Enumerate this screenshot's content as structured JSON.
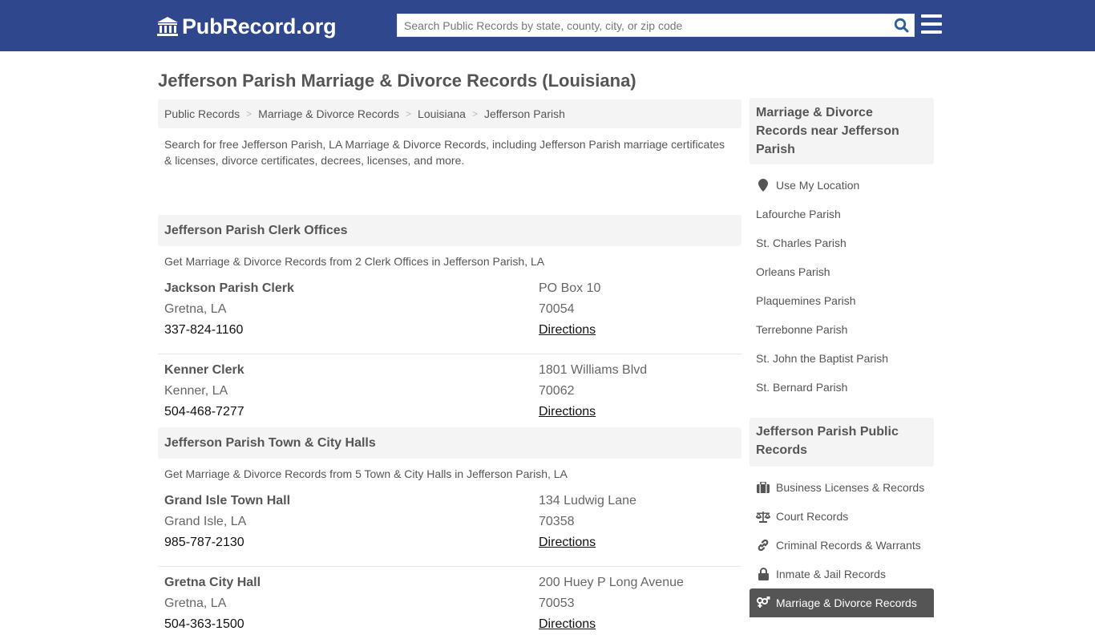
{
  "header": {
    "logo_text": "PubRecord.org",
    "search_placeholder": "Search Public Records by state, county, city, or zip code",
    "brand_color": "#2f478d"
  },
  "page_title": "Jefferson Parish Marriage & Divorce Records (Louisiana)",
  "breadcrumb": [
    {
      "label": "Public Records"
    },
    {
      "label": "Marriage & Divorce Records"
    },
    {
      "label": "Louisiana"
    },
    {
      "label": "Jefferson Parish"
    }
  ],
  "intro": "Search for free Jefferson Parish, LA Marriage & Divorce Records, including Jefferson Parish marriage certificates & licenses, divorce certificates, decrees, licenses, and more.",
  "sections": [
    {
      "title": "Jefferson Parish Clerk Offices",
      "description": "Get Marriage & Divorce Records from 2 Clerk Offices in Jefferson Parish, LA",
      "records": [
        {
          "name": "Jackson Parish Clerk",
          "city": "Gretna, LA",
          "phone": "337-824-1160",
          "address": "PO Box 10",
          "zip": "70054",
          "directions": "Directions"
        },
        {
          "name": "Kenner Clerk",
          "city": "Kenner, LA",
          "phone": "504-468-7277",
          "address": "1801 Williams Blvd",
          "zip": "70062",
          "directions": "Directions"
        }
      ]
    },
    {
      "title": "Jefferson Parish Town & City Halls",
      "description": "Get Marriage & Divorce Records from 5 Town & City Halls in Jefferson Parish, LA",
      "records": [
        {
          "name": "Grand Isle Town Hall",
          "city": "Grand Isle, LA",
          "phone": "985-787-2130",
          "address": "134 Ludwig Lane",
          "zip": "70358",
          "directions": "Directions"
        },
        {
          "name": "Gretna City Hall",
          "city": "Gretna, LA",
          "phone": "504-363-1500",
          "address": "200 Huey P Long Avenue",
          "zip": "70053",
          "directions": "Directions"
        }
      ]
    }
  ],
  "sidebar": {
    "nearby_title": "Marriage & Divorce Records near Jefferson Parish",
    "use_location": "Use My Location",
    "nearby": [
      "Lafourche Parish",
      "St. Charles Parish",
      "Orleans Parish",
      "Plaquemines Parish",
      "Terrebonne Parish",
      "St. John the Baptist Parish",
      "St. Bernard Parish"
    ],
    "public_title": "Jefferson Parish Public Records",
    "public": [
      {
        "label": "Business Licenses & Records",
        "icon": "briefcase-icon"
      },
      {
        "label": "Court Records",
        "icon": "scales-icon"
      },
      {
        "label": "Criminal Records & Warrants",
        "icon": "link-icon"
      },
      {
        "label": "Inmate & Jail Records",
        "icon": "lock-icon"
      },
      {
        "label": "Marriage & Divorce Records",
        "icon": "gender-icon",
        "active": true
      }
    ]
  }
}
